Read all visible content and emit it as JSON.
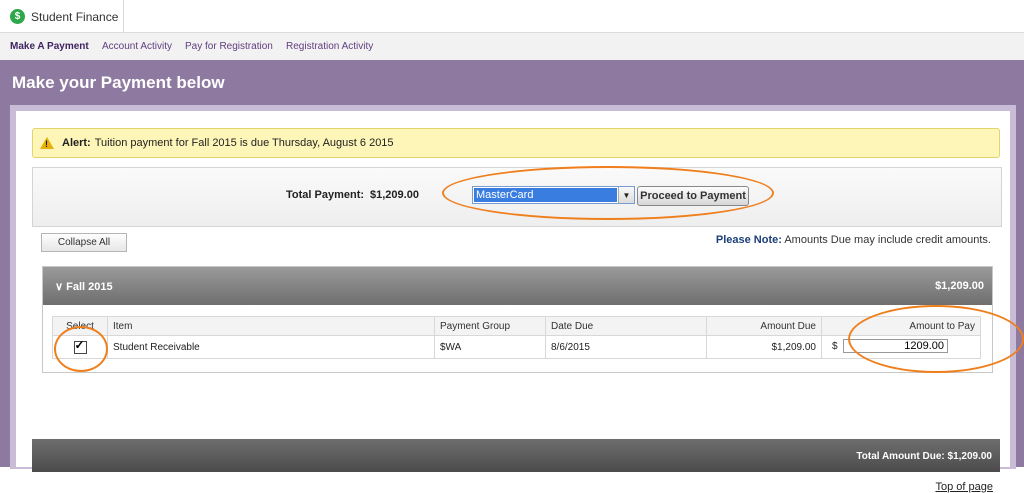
{
  "app_tab": {
    "icon": "dollar-icon",
    "label": "Student Finance"
  },
  "subnav": [
    {
      "label": "Make A Payment",
      "active": true
    },
    {
      "label": "Account Activity"
    },
    {
      "label": "Pay for Registration"
    },
    {
      "label": "Registration Activity"
    }
  ],
  "page_title": "Make your Payment below",
  "alert": {
    "icon": "warning-icon",
    "label": "Alert:",
    "text": "Tuition payment for Fall 2015 is due Thursday, August 6 2015"
  },
  "payment": {
    "total_label": "Total Payment:",
    "total_value": "$1,209.00",
    "method_selected": "MasterCard",
    "proceed_label": "Proceed to Payment"
  },
  "collapse_label": "Collapse All",
  "note": {
    "label": "Please Note:",
    "text": " Amounts Due may include credit amounts."
  },
  "term": {
    "name": "Fall 2015",
    "amount": "$1,209.00"
  },
  "table": {
    "headers": [
      "Select",
      "Item",
      "Payment Group",
      "Date Due",
      "Amount Due",
      "Amount to Pay"
    ],
    "rows": [
      {
        "selected": true,
        "item": "Student Receivable",
        "group": "$WA",
        "date_due": "8/6/2015",
        "amount_due": "$1,209.00",
        "currency": "$",
        "amount_to_pay": "1209.00"
      }
    ]
  },
  "total_amount_due": "Total Amount Due: $1,209.00",
  "top_link": "Top of page",
  "colors": {
    "frame": "#8e7aa0",
    "annotation": "#ef7f1c",
    "alert_bg": "#fdf6b8"
  }
}
